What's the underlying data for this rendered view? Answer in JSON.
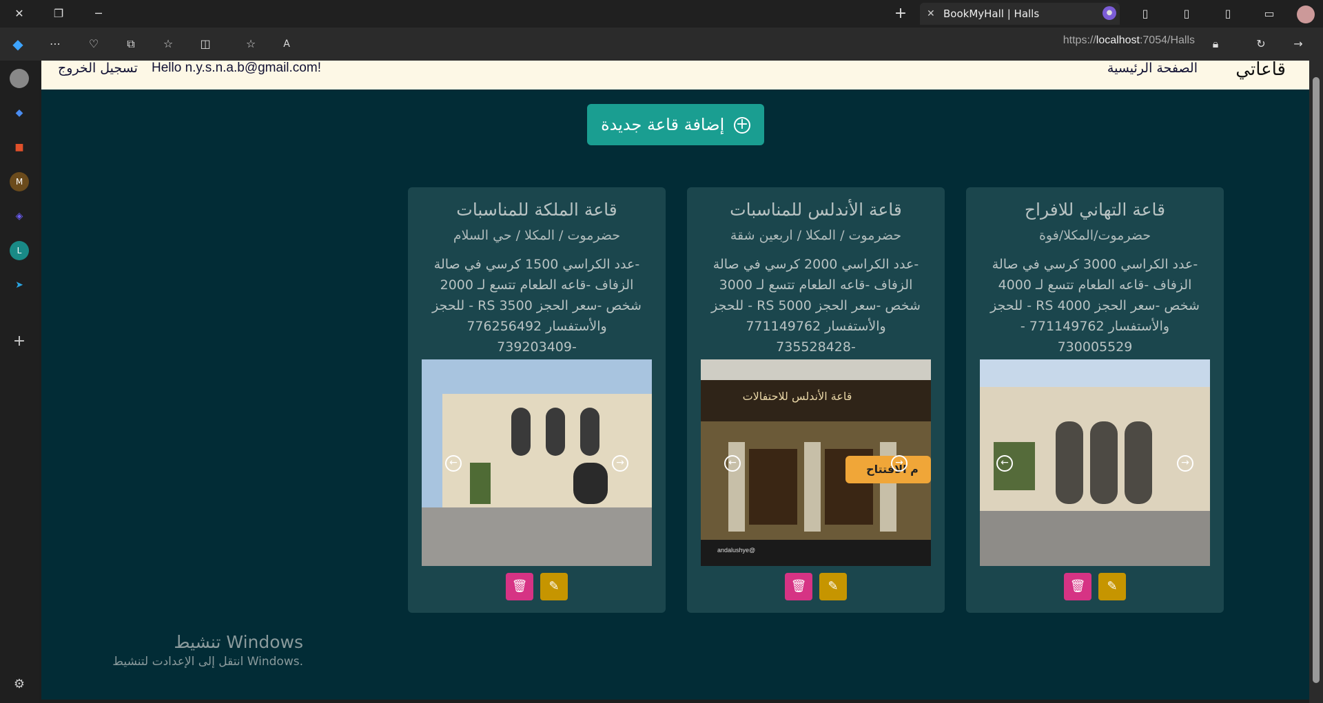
{
  "browser": {
    "tab_title": "BookMyHall | Halls",
    "url_prefix": "https://",
    "url_host": "localhost",
    "url_rest": ":7054/Halls"
  },
  "navbar": {
    "brand": "قاعاتي",
    "home": "الصفحة الرئيسية",
    "hello": "Hello n.y.s.n.a.b@gmail.com!",
    "logout": "تسجيل الخروج"
  },
  "add_button": {
    "label": "إضافة قاعة جديدة"
  },
  "halls": [
    {
      "name": "قاعة التهاني للافراح",
      "location": "حضرموت/المكلا/فوة",
      "description": "-عدد الكراسي 3000 كرسي في صالة الزفاف -قاعه الطعام تتسع لـ 4000 شخص -سعر الحجز RS 4000 - للحجز والأستفسار 771149762 - 730005529"
    },
    {
      "name": "قاعة الأندلس للمناسبات",
      "location": "حضرموت / المكلا / اربعين شقة",
      "description": "-عدد الكراسي 2000 كرسي في صالة الزفاف -قاعه الطعام تتسع لـ 3000 شخص -سعر الحجز RS 5000 - للحجز والأستفسار 771149762 -735528428"
    },
    {
      "name": "قاعة الملكة للمناسبات",
      "location": "حضرموت / المكلا / حي السلام",
      "description": "-عدد الكراسي 1500 كرسي في صالة الزفاف -قاعه الطعام تتسع لـ 2000 شخص -سعر الحجز RS 3500 - للحجز والأستفسار 776256492 -739203409"
    }
  ],
  "photo_text": {
    "andalus_sign": "قاعة الأندلس للاحتفالات",
    "andalus_banner": "م الافتتاح",
    "andalus_footer": "@andalushye"
  },
  "windows_watermark": {
    "title": "تنشيط Windows",
    "subtitle": "انتقل إلى الإعدادت لتنشيط Windows."
  }
}
